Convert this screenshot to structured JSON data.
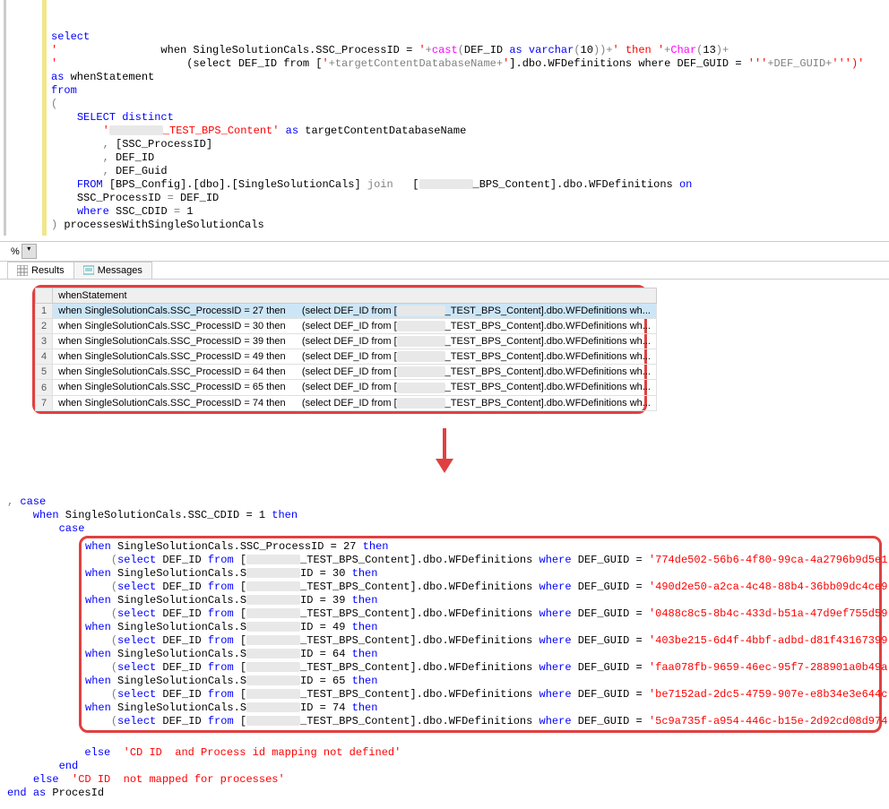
{
  "topcode": {
    "select": "select",
    "whenPrefix": "                when SingleSolutionCals.SSC_ProcessID = ",
    "castPrefix": "cast",
    "castBody": "(DEF_ID ",
    "asKw": "as",
    "varcharPart": " varchar",
    "tenClose": "(10))+",
    "thenStr": "' then '",
    "plusChar": "+",
    "charFn": "Char",
    "char13": "(13)+",
    "line2a": "                    (select DEF_ID from [",
    "tcdn": "+targetContentDatabaseName+",
    "line2b": "].dbo.WFDefinitions where DEF_GUID = ",
    "tripleQ1": "'''",
    "defguid": "+DEF_GUID+",
    "tripleQ2": "''')'",
    "asWhen": "as",
    "whenStatement": " whenStatement",
    "from": "from",
    "paren": "(",
    "selectDistinct": "SELECT distinct",
    "strTest": "_TEST_BPS_Content'",
    "asTarget": " as",
    "targetName": " targetContentDatabaseName",
    "ssc": ", [SSC_ProcessID]",
    "defid": ", DEF_ID",
    "defguid2": ", DEF_Guid",
    "fromKw": "FROM",
    "fromBody": " [BPS_Config].[dbo].[SingleSolutionCals] ",
    "joinKw": "join",
    "joinBody": "   [",
    "bpsContent": "_BPS_Content].dbo.WFDefinitions ",
    "onKw": "on",
    "sscEq": "SSC_ProcessID ",
    "eq": "=",
    "defidRef": " DEF_ID",
    "whereKw": "where",
    "sscCdid": " SSC_CDID ",
    "one": " 1",
    "closeParen": ")",
    "procName": " processesWithSingleSolutionCals"
  },
  "pct": "%",
  "tabs": {
    "results": "Results",
    "messages": "Messages"
  },
  "grid": {
    "header": "whenStatement",
    "rows": [
      {
        "n": "1",
        "a": "when SingleSolutionCals.SSC_ProcessID = 27 then",
        "b": "(select DEF_ID from [",
        "c": "_TEST_BPS_Content].dbo.WFDefinitions wh..."
      },
      {
        "n": "2",
        "a": "when SingleSolutionCals.SSC_ProcessID = 30 then",
        "b": "(select DEF_ID from [",
        "c": "_TEST_BPS_Content].dbo.WFDefinitions wh..."
      },
      {
        "n": "3",
        "a": "when SingleSolutionCals.SSC_ProcessID = 39 then",
        "b": "(select DEF_ID from [",
        "c": "_TEST_BPS_Content].dbo.WFDefinitions wh..."
      },
      {
        "n": "4",
        "a": "when SingleSolutionCals.SSC_ProcessID = 49 then",
        "b": "(select DEF_ID from [",
        "c": "_TEST_BPS_Content].dbo.WFDefinitions wh..."
      },
      {
        "n": "5",
        "a": "when SingleSolutionCals.SSC_ProcessID = 64 then",
        "b": "(select DEF_ID from [",
        "c": "_TEST_BPS_Content].dbo.WFDefinitions wh..."
      },
      {
        "n": "6",
        "a": "when SingleSolutionCals.SSC_ProcessID = 65 then",
        "b": "(select DEF_ID from [",
        "c": "_TEST_BPS_Content].dbo.WFDefinitions wh..."
      },
      {
        "n": "7",
        "a": "when SingleSolutionCals.SSC_ProcessID = 74 then",
        "b": "(select DEF_ID from [",
        "c": "_TEST_BPS_Content].dbo.WFDefinitions wh..."
      }
    ]
  },
  "lower": {
    "caseKw": ", case",
    "whenCdid": "    when",
    "cdidBody": " SingleSolutionCals.SSC_CDID = 1 ",
    "thenKw": "then",
    "innerCase": "        case",
    "rows": [
      {
        "id": "27",
        "guid": "'774de502-56b6-4f80-99ca-4a2796b9d5e1'"
      },
      {
        "id": "30",
        "guid": "'490d2e50-a2ca-4c48-88b4-36bb09dc4ce9'"
      },
      {
        "id": "39",
        "guid": "'0488c8c5-8b4c-433d-b51a-47d9ef755d59'"
      },
      {
        "id": "49",
        "guid": "'403be215-6d4f-4bbf-adbd-d81f43167399'"
      },
      {
        "id": "64",
        "guid": "'faa078fb-9659-46ec-95f7-288901a0b49a'"
      },
      {
        "id": "65",
        "guid": "'be7152ad-2dc5-4759-907e-e8b34e3e644c'"
      },
      {
        "id": "74",
        "guid": "'5c9a735f-a954-446c-b15e-2d92cd08d974'"
      }
    ],
    "whenPrefix": "when",
    "whenBody1": " SingleSolutionCals.SSC_ProcessID = ",
    "whenBody1b": " SingleSolutionCals.S",
    "idSuffix": "ID = ",
    "selectLine": "    (",
    "selectKw": "select",
    "defFrom": " DEF_ID ",
    "fromKw": "from",
    "bracket": " [",
    "testContent": "_TEST_BPS_Content].dbo.WFDefinitions ",
    "whereKw": "where",
    "defguidEq": " DEF_GUID = ",
    "closeP": ")",
    "elseKw": "else",
    "elseStr1": "'CD ID  and Process id mapping not defined'",
    "endKw": "end",
    "elseStr2": "'CD ID  not mapped for processes'",
    "asKw": "as",
    "procId": " ProcesId"
  }
}
